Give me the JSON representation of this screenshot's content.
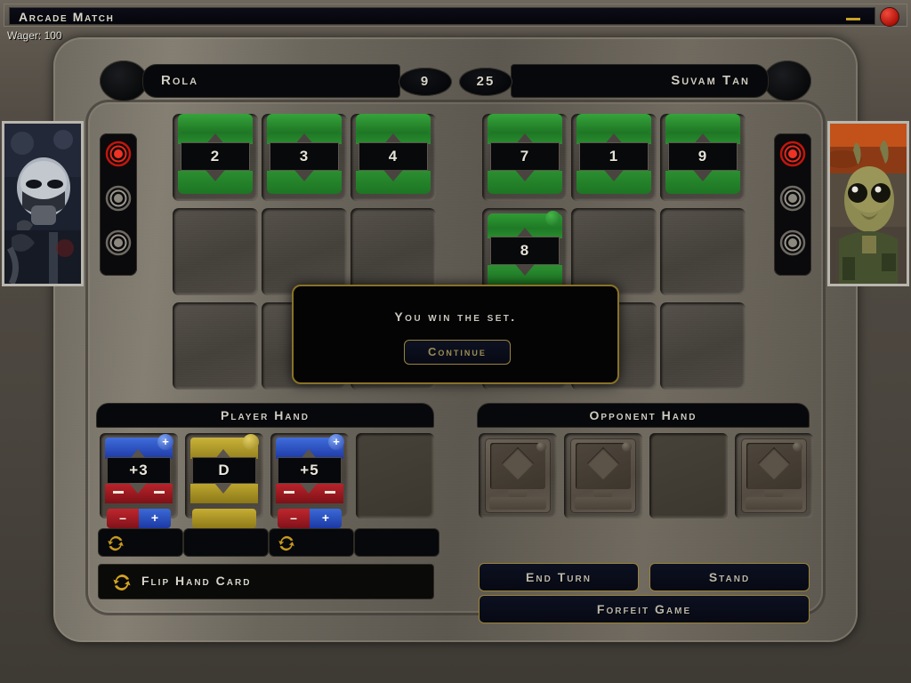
{
  "window": {
    "title": "Arcade Match",
    "wager_label": "Wager: 100",
    "minimize_icon": "minimize-icon",
    "close_icon": "close-icon"
  },
  "players": {
    "left": {
      "name": "Rola",
      "score": "9",
      "portrait_alt": "at-at-pilot-portrait",
      "lights_lit": 1,
      "lights_total": 3
    },
    "right": {
      "name": "Suvam Tan",
      "score": "25",
      "portrait_alt": "rodian-alien-portrait",
      "lights_lit": 1,
      "lights_total": 3
    }
  },
  "table": {
    "player_cards": [
      {
        "value": "2"
      },
      {
        "value": "3"
      },
      {
        "value": "4"
      }
    ],
    "opponent_cards_row1": [
      {
        "value": "7"
      },
      {
        "value": "1"
      },
      {
        "value": "9"
      }
    ],
    "opponent_cards_row2": [
      {
        "value": "8"
      }
    ]
  },
  "hands": {
    "player": {
      "label": "Player Hand",
      "cards": [
        {
          "value": "+3",
          "top_color": "blue",
          "bottom_color": "red",
          "badge": "+",
          "has_flip": true
        },
        {
          "value": "D",
          "top_color": "gold",
          "bottom_color": "gold",
          "badge": "",
          "has_flip": false
        },
        {
          "value": "+5",
          "top_color": "blue",
          "bottom_color": "red",
          "badge": "+",
          "has_flip": true
        },
        {
          "value": "",
          "top_color": "",
          "bottom_color": "",
          "badge": "",
          "has_flip": false
        }
      ]
    },
    "opponent": {
      "label": "Opponent Hand",
      "cards": [
        {
          "face_down": true
        },
        {
          "face_down": true
        },
        {
          "face_down": false
        },
        {
          "face_down": true
        }
      ]
    }
  },
  "tooltip": {
    "text": "Flip Hand Card",
    "icon": "refresh-icon"
  },
  "actions": {
    "end_turn": "End Turn",
    "stand": "Stand",
    "forfeit": "Forfeit Game"
  },
  "dialog": {
    "message": "You win the set.",
    "button": "Continue"
  },
  "colors": {
    "accent_gold": "#9a8438",
    "card_green": "#2a8d2f",
    "card_blue": "#1d39a6",
    "card_red": "#7d1117",
    "card_gold": "#96821d",
    "led_on": "#e01b10"
  }
}
